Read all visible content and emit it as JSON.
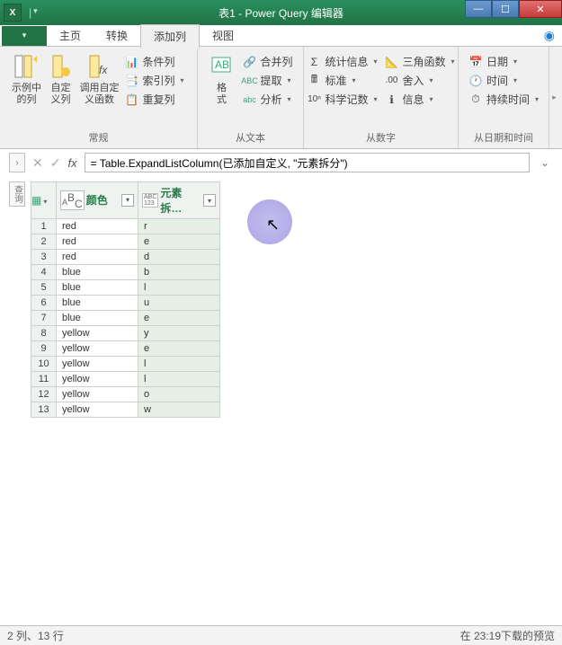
{
  "title": "表1 - Power Query 编辑器",
  "tabs": {
    "home": "主页",
    "transform": "转换",
    "addcol": "添加列",
    "view": "视图"
  },
  "ribbon": {
    "g1": {
      "label": "常规",
      "btn1": "示例中\n的列",
      "btn2": "自定\n义列",
      "btn3": "调用自定\n义函数",
      "cond": "条件列",
      "index": "索引列",
      "dup": "重复列"
    },
    "g2": {
      "label": "从文本",
      "fmt": "格\n式",
      "merge": "合并列",
      "extract": "提取",
      "parse": "分析"
    },
    "g3": {
      "label": "从数字",
      "stat": "统计信息",
      "std": "标准",
      "sci": "科学记数",
      "trig": "三角函数",
      "round": "舍入",
      "info": "信息"
    },
    "g4": {
      "label": "从日期和时间",
      "date": "日期",
      "time": "时间",
      "dur": "持续时间"
    }
  },
  "formula": "= Table.ExpandListColumn(已添加自定义, \"元素拆分\")",
  "columns": [
    {
      "type": "A<sup>B</sup><sub>C</sub>",
      "name": "颜色"
    },
    {
      "type": "ABC\n123",
      "name": "元素拆…"
    }
  ],
  "rows": [
    {
      "n": 1,
      "c0": "red",
      "c1": "r"
    },
    {
      "n": 2,
      "c0": "red",
      "c1": "e"
    },
    {
      "n": 3,
      "c0": "red",
      "c1": "d"
    },
    {
      "n": 4,
      "c0": "blue",
      "c1": "b"
    },
    {
      "n": 5,
      "c0": "blue",
      "c1": "l"
    },
    {
      "n": 6,
      "c0": "blue",
      "c1": "u"
    },
    {
      "n": 7,
      "c0": "blue",
      "c1": "e"
    },
    {
      "n": 8,
      "c0": "yellow",
      "c1": "y"
    },
    {
      "n": 9,
      "c0": "yellow",
      "c1": "e"
    },
    {
      "n": 10,
      "c0": "yellow",
      "c1": "l"
    },
    {
      "n": 11,
      "c0": "yellow",
      "c1": "l"
    },
    {
      "n": 12,
      "c0": "yellow",
      "c1": "o"
    },
    {
      "n": 13,
      "c0": "yellow",
      "c1": "w"
    }
  ],
  "status": {
    "left": "2 列、13 行",
    "right": "在 23:19下载的预览"
  }
}
